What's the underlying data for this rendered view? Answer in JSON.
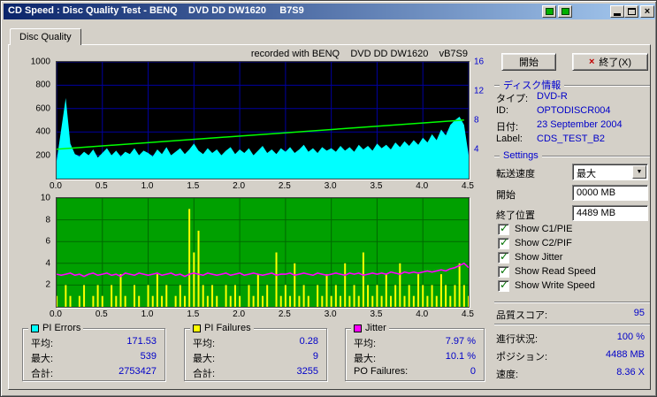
{
  "window": {
    "title": "CD Speed : Disc Quality Test - BENQ    DVD DD DW1620     B7S9",
    "tab": "Disc Quality",
    "close_glyph": "×"
  },
  "colors": {
    "titlebar_start": "#0a246a",
    "titlebar_end": "#a6caf0",
    "dialog_bg": "#d4d0c8",
    "value_text": "#0000c8",
    "section_header_text": "#0000d0",
    "check_green": "#007000",
    "exit_x_red": "#c00000"
  },
  "chart_data": [
    {
      "type": "area",
      "title": "recorded with BENQ    DVD DD DW1620    vB7S9",
      "x_min": 0,
      "x_max": 4.5,
      "x_ticks": [
        "0.0",
        "0.5",
        "1.0",
        "1.5",
        "2.0",
        "2.5",
        "3.0",
        "3.5",
        "4.0",
        "4.5"
      ],
      "y_min": 0,
      "y_max": 1000,
      "y_ticks_left": [
        1000,
        800,
        600,
        400,
        200
      ],
      "y_ticks_right": [
        16,
        12,
        8,
        4
      ],
      "right_axis_max": 16,
      "bg": "#000000",
      "grid_color": "#0000a0",
      "series": [
        {
          "name": "PI Errors",
          "type": "area",
          "color": "#00ffff",
          "step": 0.05,
          "values": [
            150,
            420,
            690,
            300,
            210,
            190,
            230,
            200,
            250,
            180,
            220,
            260,
            200,
            240,
            190,
            230,
            210,
            260,
            200,
            240,
            220,
            190,
            250,
            210,
            270,
            200,
            230,
            260,
            210,
            250,
            300,
            240,
            210,
            260,
            220,
            250,
            200,
            240,
            270,
            210,
            250,
            220,
            260,
            200,
            240,
            280,
            220,
            250,
            210,
            260,
            230,
            270,
            220,
            250,
            290,
            230,
            260,
            220,
            270,
            240,
            260,
            230,
            280,
            240,
            270,
            230,
            290,
            250,
            280,
            240,
            300,
            260,
            290,
            250,
            310,
            270,
            320,
            280,
            330,
            290,
            350,
            310,
            380,
            330,
            420,
            370,
            460,
            500,
            530,
            460,
            200
          ]
        },
        {
          "name": "Write Speed",
          "type": "line",
          "color": "#00ff00",
          "width": 1.5,
          "x": [
            0,
            4.45
          ],
          "values": [
            252,
            502
          ]
        }
      ]
    },
    {
      "type": "bars",
      "title": "",
      "x_min": 0,
      "x_max": 4.5,
      "x_ticks": [
        "0.0",
        "0.5",
        "1.0",
        "1.5",
        "2.0",
        "2.5",
        "3.0",
        "3.5",
        "4.0",
        "4.5"
      ],
      "y_min": 0,
      "y_max": 10,
      "y_ticks_left": [
        10,
        8,
        6,
        4,
        2
      ],
      "bg": "#00a000",
      "grid_color": "#006800",
      "series": [
        {
          "name": "PI Failures",
          "type": "bars",
          "color": "#ffff00",
          "step": 0.05,
          "values": [
            1,
            0,
            2,
            1,
            0,
            1,
            2,
            0,
            1,
            2,
            1,
            0,
            2,
            1,
            3,
            1,
            0,
            2,
            1,
            0,
            2,
            1,
            3,
            1,
            2,
            0,
            1,
            2,
            1,
            9,
            5,
            7,
            2,
            1,
            2,
            1,
            0,
            2,
            1,
            2,
            1,
            0,
            2,
            1,
            3,
            1,
            2,
            0,
            5,
            1,
            2,
            1,
            4,
            1,
            2,
            1,
            0,
            2,
            1,
            3,
            1,
            2,
            1,
            4,
            1,
            2,
            1,
            5,
            2,
            1,
            2,
            1,
            3,
            1,
            2,
            4,
            1,
            2,
            1,
            3,
            2,
            1,
            2,
            1,
            3,
            2,
            1,
            2,
            4,
            2,
            1
          ]
        },
        {
          "name": "Jitter",
          "type": "line",
          "color": "#ff00ff",
          "width": 1.6,
          "step": 0.05,
          "values": [
            3.0,
            2.9,
            3.0,
            3.1,
            2.9,
            3.0,
            2.8,
            3.0,
            3.1,
            2.9,
            3.0,
            3.1,
            2.9,
            3.0,
            2.8,
            3.1,
            3.0,
            2.9,
            3.1,
            3.0,
            2.9,
            3.0,
            3.1,
            2.9,
            3.0,
            3.1,
            2.9,
            3.0,
            2.8,
            3.0,
            3.1,
            3.0,
            2.9,
            3.1,
            3.0,
            2.9,
            3.0,
            3.1,
            2.9,
            3.0,
            3.1,
            2.9,
            3.0,
            3.1,
            3.0,
            2.9,
            3.0,
            3.1,
            2.9,
            3.0,
            3.0,
            3.1,
            2.9,
            3.0,
            3.1,
            3.0,
            2.9,
            3.1,
            3.0,
            2.9,
            3.0,
            3.1,
            3.0,
            2.9,
            3.1,
            3.0,
            3.1,
            2.9,
            3.0,
            3.1,
            3.0,
            3.1,
            3.0,
            3.2,
            3.1,
            3.0,
            3.2,
            3.1,
            3.2,
            3.1,
            3.2,
            3.3,
            3.2,
            3.3,
            3.4,
            3.3,
            3.5,
            3.6,
            3.8,
            4.0,
            3.6
          ]
        }
      ]
    }
  ],
  "stats": {
    "pi_errors": {
      "title": "PI Errors",
      "swatch_style": "background:#00ffff;",
      "rows": [
        {
          "label": "平均:",
          "value": "171.53"
        },
        {
          "label": "最大:",
          "value": "539"
        },
        {
          "label": "合計:",
          "value": "2753427"
        }
      ]
    },
    "pi_failures": {
      "title": "PI Failures",
      "swatch_style": "background:#ffff00;",
      "rows": [
        {
          "label": "平均:",
          "value": "0.28"
        },
        {
          "label": "最大:",
          "value": "9"
        },
        {
          "label": "合計:",
          "value": "3255"
        }
      ]
    },
    "jitter": {
      "title": "Jitter",
      "swatch_style": "background:#ff00ff;",
      "rows": [
        {
          "label": "平均:",
          "value": "7.97 %"
        },
        {
          "label": "最大:",
          "value": "10.1 %"
        },
        {
          "label": "PO Failures:",
          "value": "0"
        }
      ]
    }
  },
  "panel": {
    "start_button": "開始",
    "exit_button": "終了(X)",
    "exit_icon": "×",
    "disc_info": {
      "header": "ディスク情報",
      "rows": [
        [
          "タイプ:",
          "DVD-R"
        ],
        [
          "ID:",
          "OPTODISCR004"
        ],
        [
          "日付:",
          "23 September 2004"
        ],
        [
          "Label:",
          "CDS_TEST_B2"
        ]
      ]
    },
    "settings": {
      "header": "Settings",
      "speed_label": "転送速度",
      "speed_value": "最大",
      "dropdown_glyph": "▼",
      "start_label": "開始",
      "start_value": "0000 MB",
      "end_label": "終了位置",
      "end_value": "4489 MB",
      "check_glyph": "✓",
      "checkboxes": [
        "Show C1/PIE",
        "Show C2/PIF",
        "Show Jitter",
        "Show Read Speed",
        "Show Write Speed"
      ]
    },
    "score": {
      "label": "品質スコア:",
      "value": "95"
    },
    "progress": [
      [
        "進行状況:",
        "100 %"
      ],
      [
        "ポジション:",
        "4488 MB"
      ],
      [
        "速度:",
        "8.36 X"
      ]
    ]
  }
}
